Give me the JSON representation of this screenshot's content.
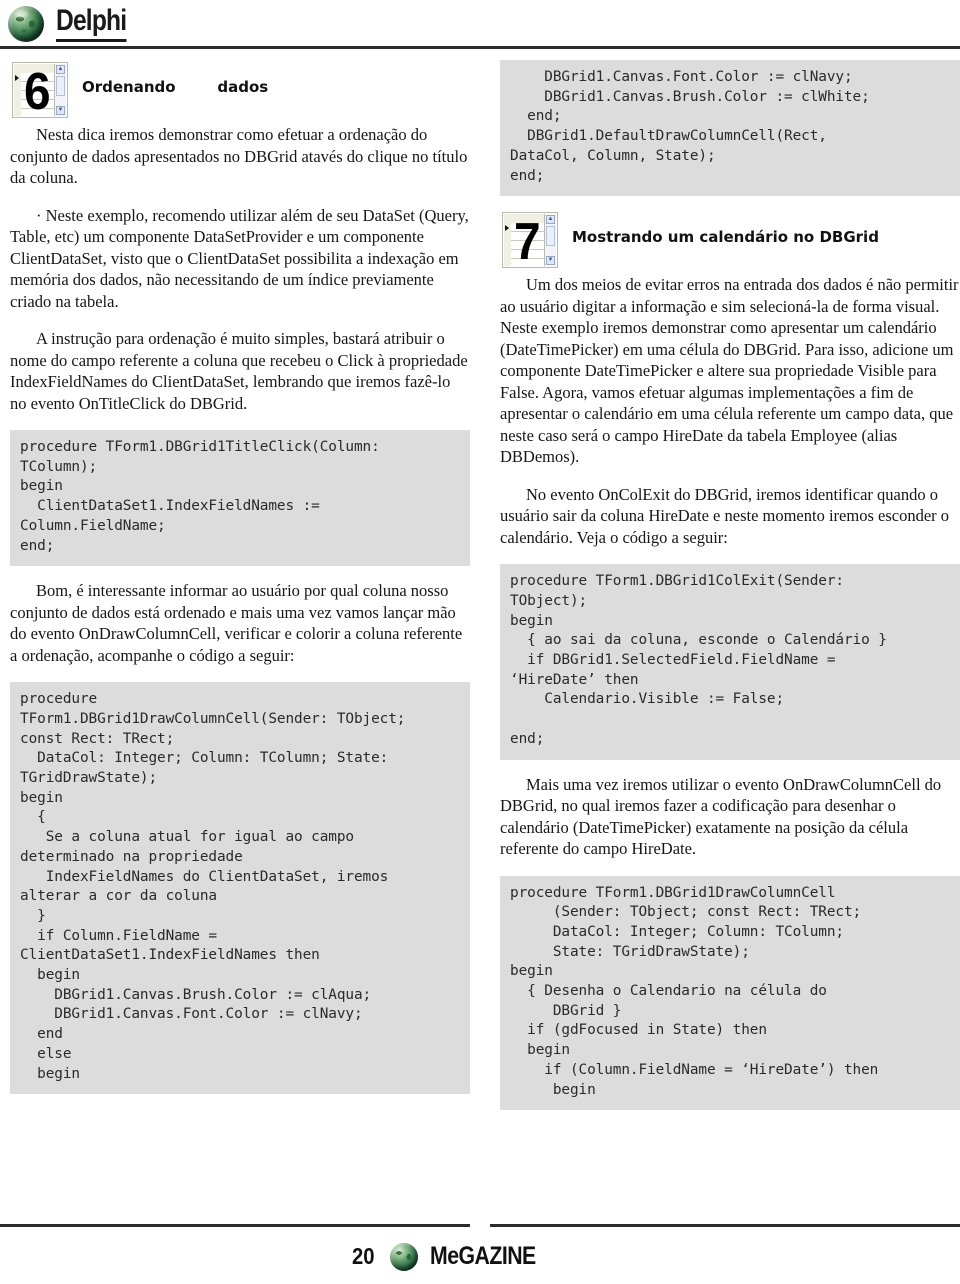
{
  "header": {
    "brand": "Delphi",
    "logo_icon": "globe-icon"
  },
  "left_column": {
    "section": {
      "number": "6",
      "title": "Ordenando        dados",
      "icon": "dbgrid-icon"
    },
    "paragraphs": {
      "p1": "Nesta dica iremos demonstrar como efetuar a ordenação do conjunto de dados apresentados no DBGrid atavés do clique no título da coluna.",
      "p2": "· Neste exemplo, recomendo utilizar além de seu DataSet (Query, Table, etc) um componente DataSetProvider e um componente ClientDataSet, visto que o ClientDataSet possibilita a indexação em memória dos dados, não necessitando de um índice previamente criado na tabela.",
      "p3": "A instrução para ordenação é muito simples, bastará atribuir o nome do campo referente a coluna que recebeu o Click à propriedade IndexFieldNames do ClientDataSet, lembrando que iremos fazê-lo no evento OnTitleClick do DBGrid.",
      "p4": "Bom, é interessante informar ao usuário por qual coluna nosso conjunto de dados está ordenado e mais uma vez vamos lançar mão do evento OnDrawColumnCell, verificar e colorir a coluna referente a ordenação, acompanhe o código a seguir:"
    },
    "code1": "procedure TForm1.DBGrid1TitleClick(Column:\nTColumn);\nbegin\n  ClientDataSet1.IndexFieldNames :=\nColumn.FieldName;\nend;",
    "code2": "procedure\nTForm1.DBGrid1DrawColumnCell(Sender: TObject;\nconst Rect: TRect;\n  DataCol: Integer; Column: TColumn; State:\nTGridDrawState);\nbegin\n  {\n   Se a coluna atual for igual ao campo\ndeterminado na propriedade\n   IndexFieldNames do ClientDataSet, iremos\nalterar a cor da coluna\n  }\n  if Column.FieldName =\nClientDataSet1.IndexFieldNames then\n  begin\n    DBGrid1.Canvas.Brush.Color := clAqua;\n    DBGrid1.Canvas.Font.Color := clNavy;\n  end\n  else\n  begin"
  },
  "right_column": {
    "code_top": "    DBGrid1.Canvas.Font.Color := clNavy;\n    DBGrid1.Canvas.Brush.Color := clWhite;\n  end;\n  DBGrid1.DefaultDrawColumnCell(Rect,\nDataCol, Column, State);\nend;",
    "section": {
      "number": "7",
      "title": "Mostrando um calendário no DBGrid",
      "icon": "dbgrid-icon"
    },
    "paragraphs": {
      "p1": "Um dos meios de evitar erros na entrada dos dados é não permitir ao usuário digitar a informação e sim selecioná-la de forma visual. Neste exemplo iremos demonstrar como apresentar um calendário (DateTimePicker) em uma célula do DBGrid. Para isso, adicione um componente DateTimePicker e altere sua propriedade Visible para False. Agora, vamos efetuar algumas implementações a fim de apresentar o calendário em uma célula referente um campo data, que neste caso será o campo HireDate da tabela Employee (alias DBDemos).",
      "p2": "No evento OnColExit do DBGrid, iremos identificar quando o usuário sair da coluna HireDate e neste momento iremos esconder o calendário. Veja o código a seguir:",
      "p3": "Mais uma vez iremos utilizar o evento OnDrawColumnCell do DBGrid, no qual iremos fazer a codificação para desenhar o calendário (DateTimePicker) exatamente na posição da célula referente do campo HireDate."
    },
    "code1": "procedure TForm1.DBGrid1ColExit(Sender:\nTObject);\nbegin\n  { ao sai da coluna, esconde o Calendário }\n  if DBGrid1.SelectedField.FieldName =\n‘HireDate’ then\n    Calendario.Visible := False;\n\nend;",
    "code2": "procedure TForm1.DBGrid1DrawColumnCell\n     (Sender: TObject; const Rect: TRect;\n     DataCol: Integer; Column: TColumn;\n     State: TGridDrawState);\nbegin\n  { Desenha o Calendario na célula do\n     DBGrid }\n  if (gdFocused in State) then\n  begin\n    if (Column.FieldName = ‘HireDate’) then\n     begin"
  },
  "footer": {
    "page_number": "20",
    "magazine": "MeGAZINE",
    "logo_icon": "globe-icon"
  },
  "colors": {
    "code_bg": "#dcdcdc",
    "rule": "#2b2b2b",
    "text": "#161616"
  }
}
